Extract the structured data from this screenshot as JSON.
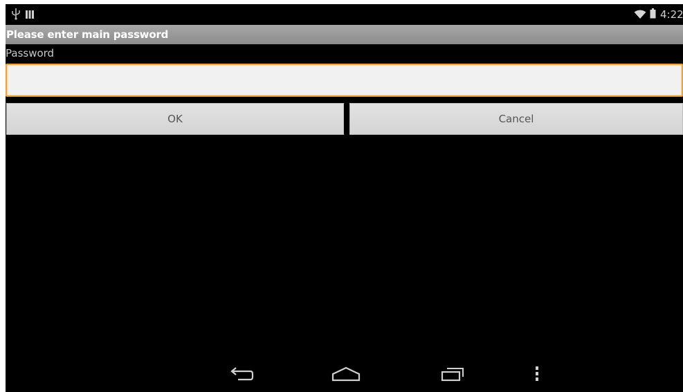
{
  "status_bar": {
    "time": "4:22",
    "icons": [
      "usb-icon",
      "signal-bars-icon",
      "wifi-icon",
      "battery-icon"
    ]
  },
  "dialog": {
    "title": "Please enter main password",
    "field_label": "Password",
    "password_value": "",
    "ok_label": "OK",
    "cancel_label": "Cancel"
  },
  "nav_bar": {
    "icons": [
      "back-icon",
      "home-icon",
      "recent-apps-icon",
      "menu-icon"
    ]
  },
  "colors": {
    "background": "#000000",
    "title_bar": "#9a9a9a",
    "input_focus": "#f0a23a",
    "button": "#dcdcdc",
    "button_text": "#555555"
  }
}
